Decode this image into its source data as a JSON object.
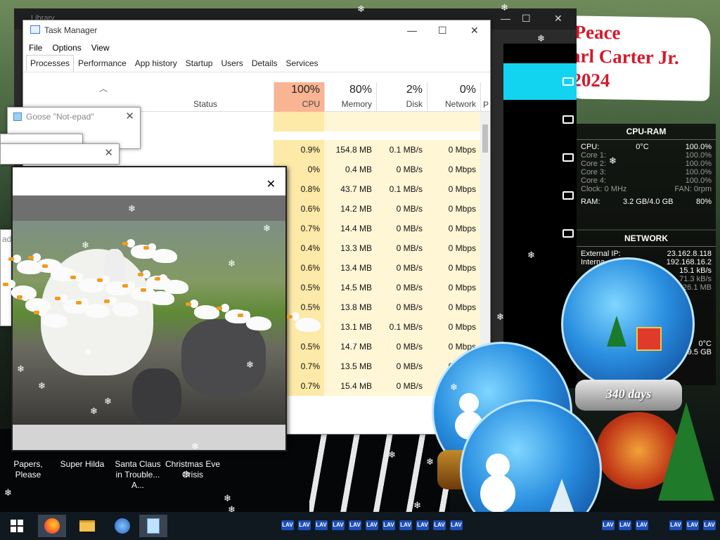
{
  "back_window": {
    "title": "Library"
  },
  "banner": {
    "line1": "Peace",
    "line2": "arl Carter Jr.",
    "line3": "2024"
  },
  "task_manager": {
    "title": "Task Manager",
    "menu": [
      "File",
      "Options",
      "View"
    ],
    "tabs": [
      "Processes",
      "Performance",
      "App history",
      "Startup",
      "Users",
      "Details",
      "Services"
    ],
    "active_tab": "Processes",
    "status_header": "Status",
    "columns": [
      {
        "pct": "100%",
        "name": "CPU"
      },
      {
        "pct": "80%",
        "name": "Memory"
      },
      {
        "pct": "2%",
        "name": "Disk"
      },
      {
        "pct": "0%",
        "name": "Network"
      }
    ],
    "extra_col": "P",
    "rows": [
      [
        "",
        "",
        "",
        ""
      ],
      [
        "0.9%",
        "154.8 MB",
        "0.1 MB/s",
        "0 Mbps"
      ],
      [
        "0%",
        "0.4 MB",
        "0 MB/s",
        "0 Mbps"
      ],
      [
        "0.8%",
        "43.7 MB",
        "0.1 MB/s",
        "0 Mbps"
      ],
      [
        "0.6%",
        "14.2 MB",
        "0 MB/s",
        "0 Mbps"
      ],
      [
        "0.7%",
        "14.4 MB",
        "0 MB/s",
        "0 Mbps"
      ],
      [
        "0.4%",
        "13.3 MB",
        "0 MB/s",
        "0 Mbps"
      ],
      [
        "0.6%",
        "13.4 MB",
        "0 MB/s",
        "0 Mbps"
      ],
      [
        "0.5%",
        "14.5 MB",
        "0 MB/s",
        "0 Mbps"
      ],
      [
        "0.5%",
        "13.8 MB",
        "0 MB/s",
        "0 Mbps"
      ],
      [
        "0.8%",
        "13.1 MB",
        "0.1 MB/s",
        "0 Mbps"
      ],
      [
        "0.5%",
        "14.7 MB",
        "0 MB/s",
        "0 Mbps"
      ],
      [
        "0.7%",
        "13.5 MB",
        "0 MB/s",
        "0 Mbps"
      ],
      [
        "0.7%",
        "15.4 MB",
        "0 MB/s",
        "0 Mbps"
      ]
    ]
  },
  "notepad": {
    "title": "Goose \"Not-epad\"",
    "small_title": "ad\""
  },
  "widgets": {
    "cpu_ram": {
      "title": "CPU-RAM",
      "cpu_label": "CPU:",
      "cpu_temp": "0°C",
      "cpu_pct": "100.0%",
      "cores": [
        {
          "label": "Core 1:",
          "value": "100.0%"
        },
        {
          "label": "Core 2:",
          "value": "100.0%"
        },
        {
          "label": "Core 3:",
          "value": "100.0%"
        },
        {
          "label": "Core 4:",
          "value": "100.0%"
        }
      ],
      "clock": "Clock: 0 MHz",
      "fan": "FAN: 0rpm",
      "ram_label": "RAM:",
      "ram_value": "3.2 GB/4.0 GB",
      "ram_pct": "80%"
    },
    "network": {
      "title": "NETWORK",
      "ext_label": "External IP:",
      "ext_value": "23.162.8.118",
      "int_label": "Interna",
      "int_value": "192.168.16.2",
      "r1": "15.1 kB/s",
      "r2": "71.3 kB/s",
      "r3": "26.1 MB",
      "temp": "0°C",
      "disk": "9.5 GB"
    }
  },
  "globes": {
    "days_label": "340 days"
  },
  "desktop_icons": [
    {
      "label": "Papers, Please"
    },
    {
      "label": "Super Hilda"
    },
    {
      "label": "Santa Claus in Trouble... A..."
    },
    {
      "label": "Christmas Eve Crisis"
    }
  ],
  "taskbar": {
    "start_icon": "windows-logo",
    "apps": [
      "firefox-icon",
      "file-explorer-icon",
      "app-icon",
      "notepad-icon"
    ],
    "tray_label": "LAV"
  }
}
